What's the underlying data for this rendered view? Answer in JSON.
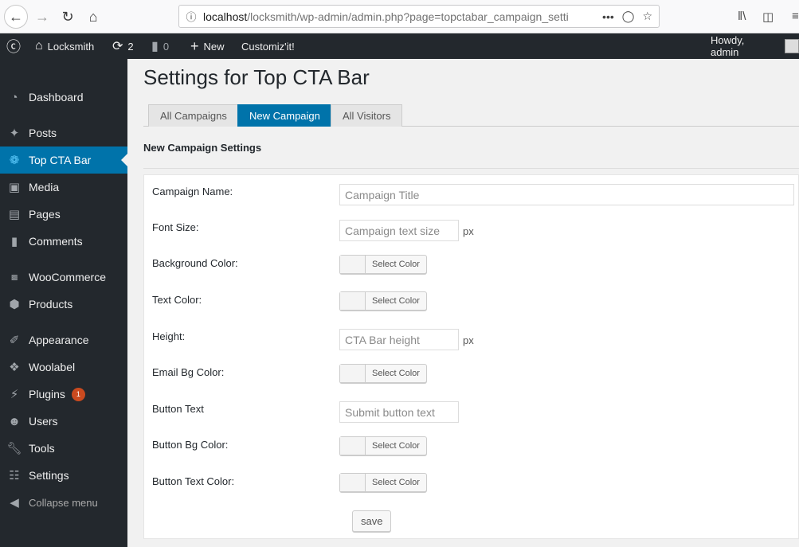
{
  "browser": {
    "url_host": "localhost",
    "url_path": "/locksmith/wp-admin/admin.php?page=topctabar_campaign_setti",
    "info_icon": "info-icon",
    "more_icon": "ellipsis-icon",
    "pocket_icon": "pocket-icon",
    "bookmark_icon": "star-icon"
  },
  "adminbar": {
    "site_name": "Locksmith",
    "updates_count": "2",
    "comments_count": "0",
    "new_label": "New",
    "customize_label": "Customiz'it!",
    "howdy": "Howdy, admin"
  },
  "sidebar": {
    "items": [
      {
        "label": "Dashboard",
        "icon": "dashboard-icon"
      },
      {
        "label": "Posts",
        "icon": "pin-icon"
      },
      {
        "label": "Top CTA Bar",
        "icon": "plugin-logo-icon"
      },
      {
        "label": "Media",
        "icon": "media-icon"
      },
      {
        "label": "Pages",
        "icon": "pages-icon"
      },
      {
        "label": "Comments",
        "icon": "comment-icon"
      },
      {
        "label": "WooCommerce",
        "icon": "woo-icon"
      },
      {
        "label": "Products",
        "icon": "box-icon"
      },
      {
        "label": "Appearance",
        "icon": "brush-icon"
      },
      {
        "label": "Woolabel",
        "icon": "tag-icon"
      },
      {
        "label": "Plugins",
        "icon": "plug-icon",
        "badge": "1"
      },
      {
        "label": "Users",
        "icon": "user-icon"
      },
      {
        "label": "Tools",
        "icon": "wrench-icon"
      },
      {
        "label": "Settings",
        "icon": "settings-icon"
      },
      {
        "label": "Collapse menu",
        "icon": "collapse-icon"
      }
    ]
  },
  "page": {
    "title": "Settings for Top CTA Bar",
    "tabs": [
      "All Campaigns",
      "New Campaign",
      "All Visitors"
    ],
    "section_heading": "New Campaign Settings"
  },
  "form": {
    "campaign_name_label": "Campaign Name:",
    "campaign_name_placeholder": "Campaign Title",
    "font_size_label": "Font Size:",
    "font_size_placeholder": "Campaign text size",
    "px": "px",
    "bg_color_label": "Background Color:",
    "text_color_label": "Text Color:",
    "height_label": "Height:",
    "height_placeholder": "CTA Bar height",
    "email_bg_label": "Email Bg Color:",
    "button_text_label": "Button Text",
    "button_text_placeholder": "Submit button text",
    "button_bg_label": "Button Bg Color:",
    "button_text_color_label": "Button Text Color:",
    "select_color": "Select Color",
    "save": "save"
  }
}
